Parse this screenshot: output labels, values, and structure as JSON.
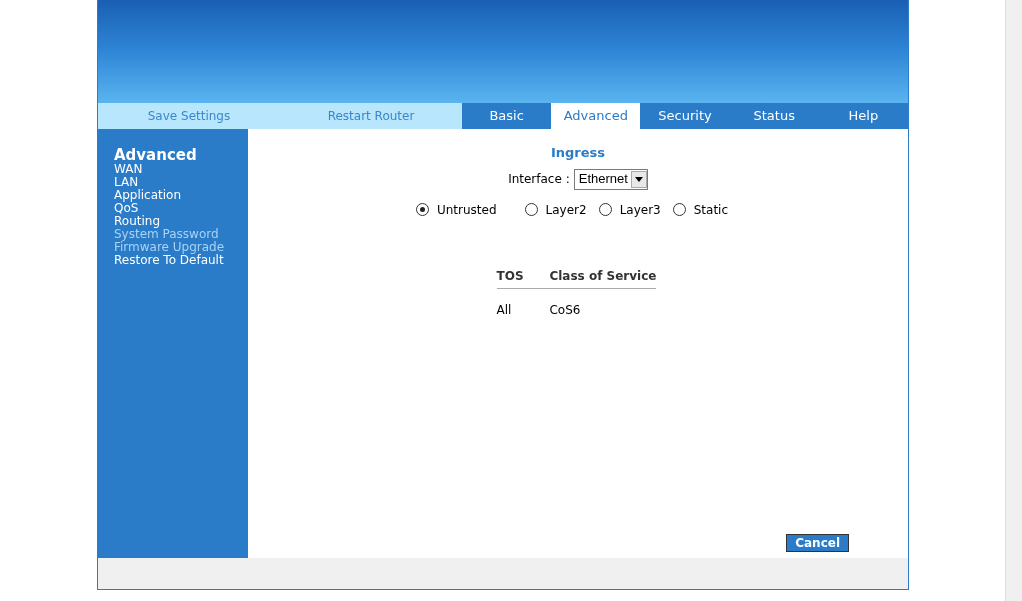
{
  "actions": [
    "Save Settings",
    "Restart Router"
  ],
  "tabs": [
    {
      "label": "Basic",
      "selected": false
    },
    {
      "label": "Advanced",
      "selected": true
    },
    {
      "label": "Security",
      "selected": false
    },
    {
      "label": "Status",
      "selected": false
    },
    {
      "label": "Help",
      "selected": false
    }
  ],
  "sidebar": {
    "title": "Advanced",
    "items": [
      {
        "label": "WAN",
        "dimmed": false
      },
      {
        "label": "LAN",
        "dimmed": false
      },
      {
        "label": "Application",
        "dimmed": false
      },
      {
        "label": "QoS",
        "dimmed": false
      },
      {
        "label": "Routing",
        "dimmed": false
      },
      {
        "label": "System Password",
        "dimmed": true
      },
      {
        "label": "Firmware Upgrade",
        "dimmed": true
      },
      {
        "label": "Restore To Default",
        "dimmed": false
      }
    ]
  },
  "heading": "Ingress",
  "interface": {
    "label": "Interface :",
    "value": "Ethernet"
  },
  "radios": [
    {
      "label": "Untrusted",
      "selected": true
    },
    {
      "label": "Layer2",
      "selected": false
    },
    {
      "label": "Layer3",
      "selected": false
    },
    {
      "label": "Static",
      "selected": false
    }
  ],
  "table": {
    "columns": [
      "TOS",
      "Class of Service"
    ],
    "rows": [
      [
        "All",
        "CoS6"
      ]
    ]
  },
  "cancel": "Cancel"
}
